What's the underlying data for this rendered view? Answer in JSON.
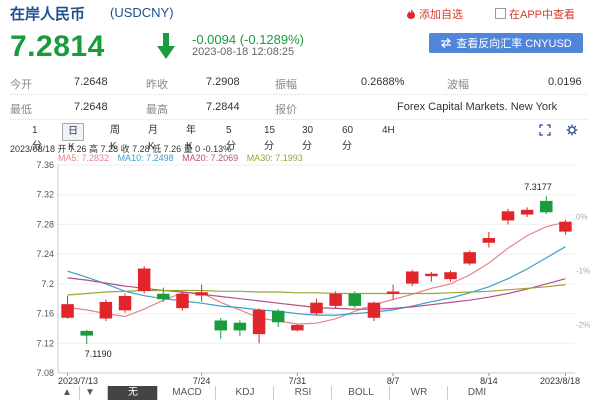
{
  "header": {
    "title": "在岸人民币",
    "code": "(USDCNY)",
    "add_favorite": "添加自选",
    "app_check": "在APP中查看"
  },
  "quote": {
    "price": "7.2814",
    "change": "-0.0094 (-0.1289%)",
    "timestamp": "2023-08-18 12:08:25",
    "direction": "down",
    "reverse_button": "查看反向汇率 CNYUSD"
  },
  "stats": {
    "row1": [
      {
        "label": "今开",
        "value": "7.2648"
      },
      {
        "label": "昨收",
        "value": "7.2908"
      },
      {
        "label": "振幅",
        "value": "0.2688%"
      },
      {
        "label": "波幅",
        "value": "0.0196"
      }
    ],
    "row2": [
      {
        "label": "最低",
        "value": "7.2648"
      },
      {
        "label": "最高",
        "value": "7.2844"
      },
      {
        "label": "报价",
        "value": "Forex Capital Markets. New York"
      }
    ]
  },
  "tabs": [
    "1分",
    "日K",
    "周K",
    "月K",
    "年K",
    "5分",
    "15分",
    "30分",
    "60分",
    "4H"
  ],
  "active_tab": "日K",
  "legend": "2023/08/18 开 7.26 高 7.28 收 7.28 低 7.26 量 0 -0.13%",
  "ma": [
    {
      "label": "MA5: 7.2832",
      "color": "#e6838b"
    },
    {
      "label": "MA10: 7.2498",
      "color": "#3aa1c6"
    },
    {
      "label": "MA20: 7.2069",
      "color": "#b74f86"
    },
    {
      "label": "MA30: 7.1993",
      "color": "#9aa534"
    }
  ],
  "bottom_tabs": [
    "▲",
    "▼",
    "无",
    "MACD",
    "KDJ",
    "RSI",
    "BOLL",
    "WR",
    "DMI"
  ],
  "bottom_active": "无",
  "colors": {
    "up": "#e0262b",
    "down": "#1a9b3c",
    "accent": "#4f86d9"
  },
  "chart_data": {
    "type": "candlestick",
    "ylim": [
      7.08,
      7.36
    ],
    "y_ticks": [
      "7.36",
      "7.32",
      "7.28",
      "7.24",
      "7.2",
      "7.16",
      "7.12",
      "7.08"
    ],
    "pct_ticks": [
      "3%",
      "2%",
      "1%",
      "0%",
      "-1%",
      "-2%",
      "-3%"
    ],
    "x_ticks": [
      "2023/7/13",
      "7/24",
      "7/31",
      "8/7",
      "8/14",
      "2023/8/18"
    ],
    "annotations": [
      "7.1190",
      "7.3177"
    ],
    "candles": [
      {
        "date": "7/13",
        "open": 7.155,
        "close": 7.172,
        "high": 7.184,
        "low": 7.153
      },
      {
        "date": "7/14",
        "open": 7.136,
        "close": 7.131,
        "high": 7.138,
        "low": 7.119
      },
      {
        "date": "7/17",
        "open": 7.154,
        "close": 7.175,
        "high": 7.179,
        "low": 7.15
      },
      {
        "date": "7/18",
        "open": 7.165,
        "close": 7.183,
        "high": 7.187,
        "low": 7.161
      },
      {
        "date": "7/19",
        "open": 7.191,
        "close": 7.22,
        "high": 7.224,
        "low": 7.187
      },
      {
        "date": "7/20",
        "open": 7.186,
        "close": 7.18,
        "high": 7.195,
        "low": 7.176
      },
      {
        "date": "7/21",
        "open": 7.168,
        "close": 7.186,
        "high": 7.19,
        "low": 7.164
      },
      {
        "date": "7/24",
        "open": 7.185,
        "close": 7.188,
        "high": 7.199,
        "low": 7.176
      },
      {
        "date": "7/25",
        "open": 7.15,
        "close": 7.138,
        "high": 7.154,
        "low": 7.126
      },
      {
        "date": "7/26",
        "open": 7.147,
        "close": 7.138,
        "high": 7.151,
        "low": 7.13
      },
      {
        "date": "7/27",
        "open": 7.133,
        "close": 7.164,
        "high": 7.167,
        "low": 7.12
      },
      {
        "date": "7/28",
        "open": 7.163,
        "close": 7.149,
        "high": 7.166,
        "low": 7.142
      },
      {
        "date": "7/31",
        "open": 7.138,
        "close": 7.144,
        "high": 7.146,
        "low": 7.136
      },
      {
        "date": "8/1",
        "open": 7.161,
        "close": 7.174,
        "high": 7.18,
        "low": 7.158
      },
      {
        "date": "8/2",
        "open": 7.171,
        "close": 7.186,
        "high": 7.19,
        "low": 7.167
      },
      {
        "date": "8/3",
        "open": 7.186,
        "close": 7.171,
        "high": 7.19,
        "low": 7.168
      },
      {
        "date": "8/4",
        "open": 7.155,
        "close": 7.174,
        "high": 7.176,
        "low": 7.15
      },
      {
        "date": "8/7",
        "open": 7.187,
        "close": 7.189,
        "high": 7.199,
        "low": 7.179
      },
      {
        "date": "8/8",
        "open": 7.201,
        "close": 7.216,
        "high": 7.219,
        "low": 7.197
      },
      {
        "date": "8/9",
        "open": 7.212,
        "close": 7.213,
        "high": 7.216,
        "low": 7.203
      },
      {
        "date": "8/10",
        "open": 7.207,
        "close": 7.215,
        "high": 7.218,
        "low": 7.203
      },
      {
        "date": "8/11",
        "open": 7.228,
        "close": 7.242,
        "high": 7.245,
        "low": 7.225
      },
      {
        "date": "8/14",
        "open": 7.256,
        "close": 7.261,
        "high": 7.27,
        "low": 7.249
      },
      {
        "date": "8/15",
        "open": 7.286,
        "close": 7.297,
        "high": 7.301,
        "low": 7.28
      },
      {
        "date": "8/16",
        "open": 7.294,
        "close": 7.299,
        "high": 7.303,
        "low": 7.29
      },
      {
        "date": "8/17",
        "open": 7.311,
        "close": 7.297,
        "high": 7.318,
        "low": 7.294
      },
      {
        "date": "8/18",
        "open": 7.271,
        "close": 7.283,
        "high": 7.286,
        "low": 7.266
      }
    ],
    "ma_series": [
      {
        "name": "MA5",
        "color": "#e6838b",
        "values": [
          7.168,
          7.165,
          7.16,
          7.156,
          7.166,
          7.178,
          7.188,
          7.188,
          7.175,
          7.165,
          7.154,
          7.15,
          7.146,
          7.147,
          7.153,
          7.163,
          7.172,
          7.179,
          7.186,
          7.194,
          7.2,
          7.212,
          7.228,
          7.248,
          7.265,
          7.277,
          7.283
        ]
      },
      {
        "name": "MA10",
        "color": "#3aa1c6",
        "values": [
          7.217,
          7.209,
          7.2,
          7.19,
          7.184,
          7.18,
          7.177,
          7.174,
          7.17,
          7.168,
          7.165,
          7.163,
          7.16,
          7.158,
          7.158,
          7.16,
          7.162,
          7.165,
          7.17,
          7.176,
          7.181,
          7.188,
          7.196,
          7.207,
          7.22,
          7.235,
          7.25
        ]
      },
      {
        "name": "MA20",
        "color": "#b74f86",
        "values": [
          7.208,
          7.205,
          7.201,
          7.197,
          7.194,
          7.191,
          7.189,
          7.186,
          7.183,
          7.18,
          7.177,
          7.174,
          7.171,
          7.168,
          7.167,
          7.166,
          7.166,
          7.167,
          7.169,
          7.172,
          7.175,
          7.178,
          7.182,
          7.187,
          7.193,
          7.2,
          7.207
        ]
      },
      {
        "name": "MA30",
        "color": "#9aa534",
        "values": [
          7.185,
          7.187,
          7.189,
          7.19,
          7.191,
          7.191,
          7.191,
          7.191,
          7.19,
          7.19,
          7.189,
          7.189,
          7.188,
          7.188,
          7.187,
          7.187,
          7.187,
          7.187,
          7.187,
          7.187,
          7.188,
          7.189,
          7.19,
          7.192,
          7.194,
          7.196,
          7.199
        ]
      }
    ]
  }
}
